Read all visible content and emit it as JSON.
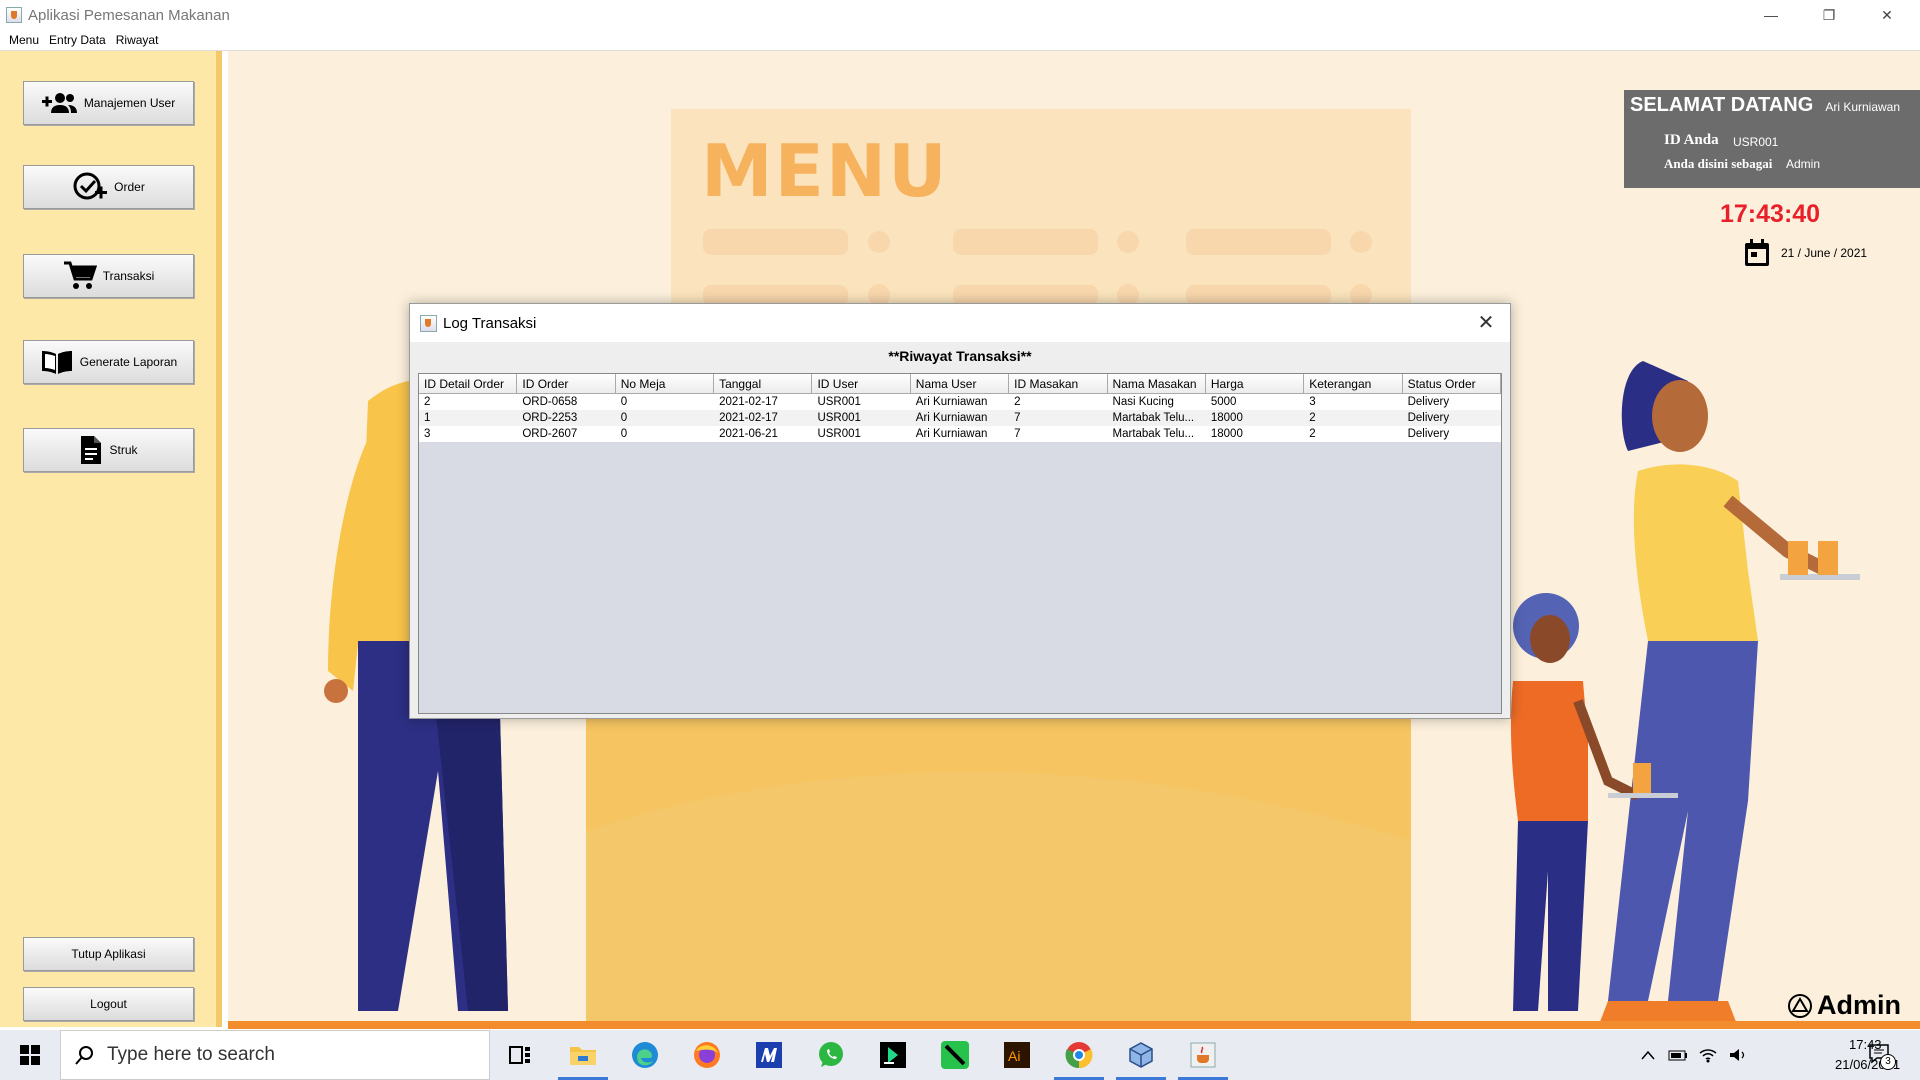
{
  "window": {
    "title": "Aplikasi Pemesanan Makanan",
    "controls": {
      "minimize": "—",
      "maximize": "❐",
      "close": "✕"
    }
  },
  "menubar": [
    "Menu",
    "Entry Data",
    "Riwayat"
  ],
  "sidebar": {
    "buttons": [
      {
        "label": "Manajemen User",
        "icon": "add-user-icon"
      },
      {
        "label": "Order",
        "icon": "check-plus-icon"
      },
      {
        "label": "Transaksi",
        "icon": "cart-icon"
      },
      {
        "label": "Generate Laporan",
        "icon": "book-icon"
      },
      {
        "label": "Struk",
        "icon": "document-icon"
      }
    ],
    "close_app": "Tutup Aplikasi",
    "logout": "Logout"
  },
  "background": {
    "menu_sign": "MENU"
  },
  "welcome": {
    "greeting": "SELAMAT DATANG",
    "user_name": "Ari Kurniawan",
    "id_label": "ID Anda",
    "id_value": "USR001",
    "role_label": "Anda disini sebagai",
    "role_value": "Admin"
  },
  "clock": {
    "time": "17:43:40",
    "date": "21 / June / 2021"
  },
  "brand": {
    "label": "Admin"
  },
  "dialog": {
    "title": "Log Transaksi",
    "heading": "**Riwayat Transaksi**",
    "columns": [
      "ID Detail Order",
      "ID Order",
      "No Meja",
      "Tanggal",
      "ID User",
      "Nama User",
      "ID Masakan",
      "Nama Masakan",
      "Harga",
      "Keterangan",
      "Status Order"
    ],
    "rows": [
      [
        "2",
        "ORD-0658",
        "0",
        "2021-02-17",
        "USR001",
        "Ari Kurniawan",
        "2",
        "Nasi Kucing",
        "5000",
        "3",
        "Delivery"
      ],
      [
        "1",
        "ORD-2253",
        "0",
        "2021-02-17",
        "USR001",
        "Ari Kurniawan",
        "7",
        "Martabak Telu...",
        "18000",
        "2",
        "Delivery"
      ],
      [
        "3",
        "ORD-2607",
        "0",
        "2021-06-21",
        "USR001",
        "Ari Kurniawan",
        "7",
        "Martabak Telu...",
        "18000",
        "2",
        "Delivery"
      ]
    ]
  },
  "taskbar": {
    "search_placeholder": "Type here to search",
    "time": "17:43",
    "date": "21/06/2021",
    "notification_count": "3"
  }
}
